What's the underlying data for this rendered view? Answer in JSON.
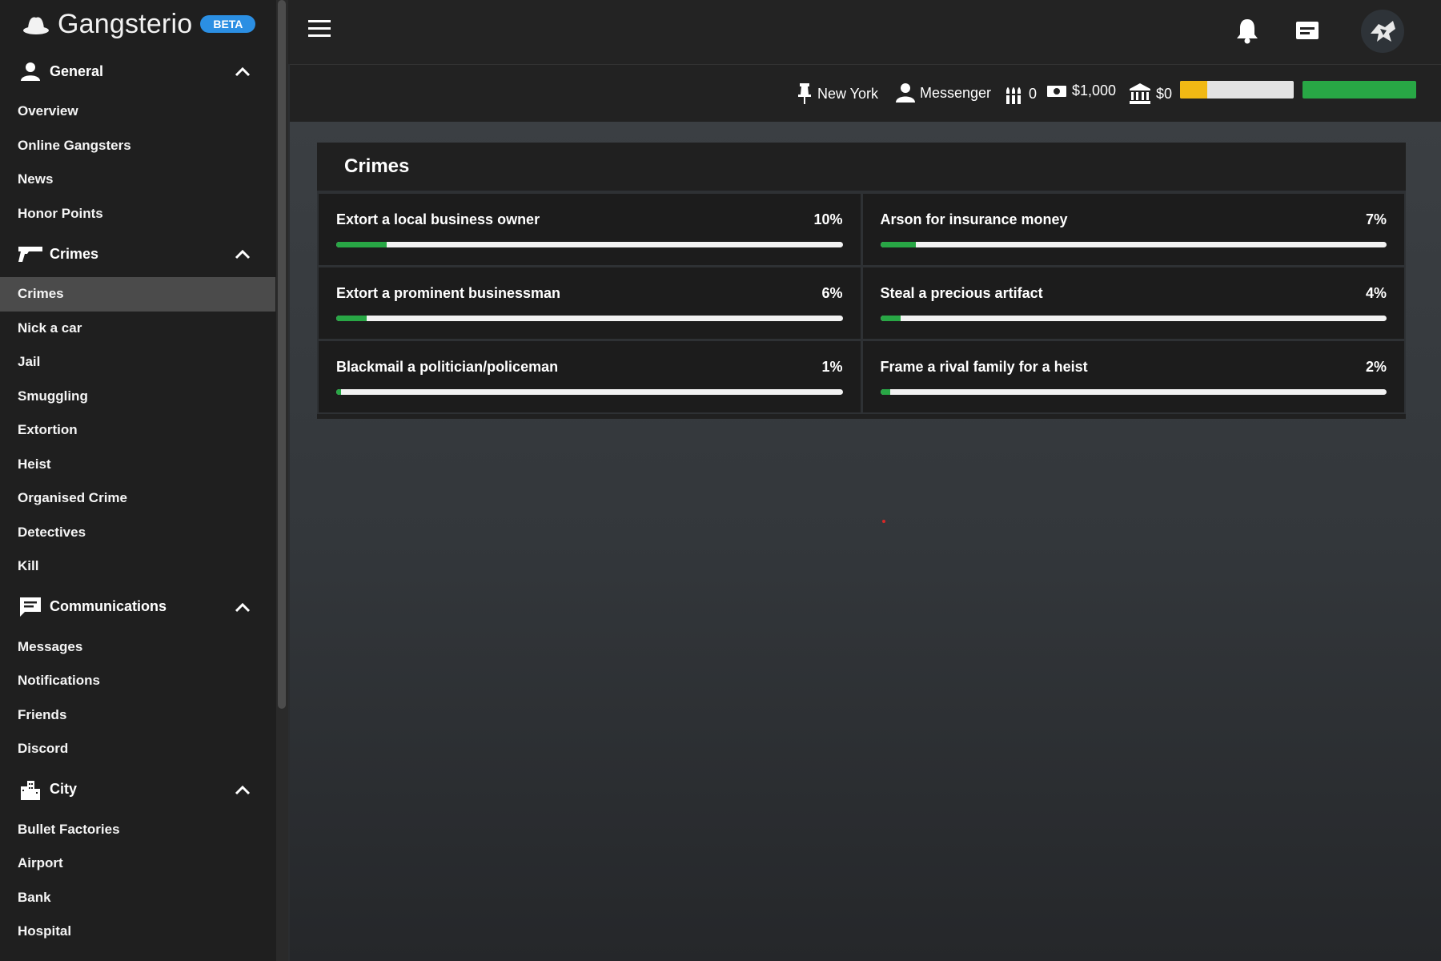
{
  "brand": {
    "name": "Gangsterio",
    "badge": "BETA"
  },
  "sidebar": {
    "sections": [
      {
        "label": "General",
        "icon": "person-icon",
        "items": [
          "Overview",
          "Online Gangsters",
          "News",
          "Honor Points"
        ]
      },
      {
        "label": "Crimes",
        "icon": "gun-icon",
        "items": [
          "Crimes",
          "Nick a car",
          "Jail",
          "Smuggling",
          "Extortion",
          "Heist",
          "Organised Crime",
          "Detectives",
          "Kill"
        ]
      },
      {
        "label": "Communications",
        "icon": "chat-icon",
        "items": [
          "Messages",
          "Notifications",
          "Friends",
          "Discord"
        ]
      },
      {
        "label": "City",
        "icon": "city-icon",
        "items": [
          "Bullet Factories",
          "Airport",
          "Bank",
          "Hospital"
        ]
      }
    ],
    "active_item": "Crimes"
  },
  "status": {
    "location": "New York",
    "rank": "Messenger",
    "bullets": "0",
    "cash": "$1,000",
    "bank": "$0",
    "progress_bar_1": 0.24,
    "progress_bar_2": 1.0
  },
  "crimes_panel": {
    "title": "Crimes",
    "crimes": [
      {
        "name": "Extort a local business owner",
        "pct_label": "10%",
        "pct": 10
      },
      {
        "name": "Arson for insurance money",
        "pct_label": "7%",
        "pct": 7
      },
      {
        "name": "Extort a prominent businessman",
        "pct_label": "6%",
        "pct": 6
      },
      {
        "name": "Steal a precious artifact",
        "pct_label": "4%",
        "pct": 4
      },
      {
        "name": "Blackmail a politician/policeman",
        "pct_label": "1%",
        "pct": 1
      },
      {
        "name": "Frame a rival family for a heist",
        "pct_label": "2%",
        "pct": 2
      }
    ]
  },
  "colors": {
    "accent_green": "#28a745",
    "accent_yellow": "#f1b914",
    "badge_blue": "#2b8fe3"
  },
  "icons": [
    "menu-icon",
    "bell-icon",
    "mail-icon",
    "avatar",
    "pin-icon",
    "person-icon",
    "bullets-icon",
    "cash-icon",
    "bank-icon"
  ]
}
